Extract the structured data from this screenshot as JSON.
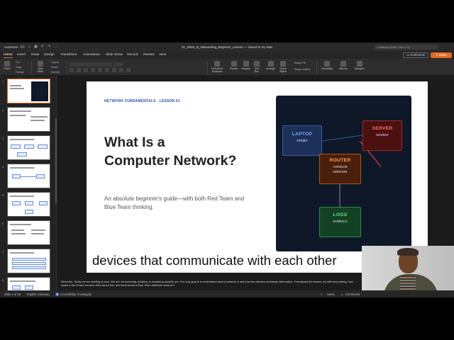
{
  "titlebar": {
    "autosave": "AutoSave",
    "document": "01_What_Is_Networking_Beginner_Lesson",
    "save_state": "Saved to my Mac",
    "search": "Search (Cmd + Ctrl + U)"
  },
  "tabs": [
    "Home",
    "Insert",
    "Draw",
    "Design",
    "Transitions",
    "Animations",
    "Slide Show",
    "Record",
    "Review",
    "View"
  ],
  "actions": {
    "comments": "Comments",
    "share": "Share"
  },
  "ribbon": {
    "paste": "Paste",
    "cut": "Cut",
    "copy": "Copy",
    "format": "Format",
    "new_slide": "New Slide",
    "layout": "Layout",
    "reset": "Reset",
    "section": "Section",
    "convert_smartart": "Convert to SmartArt",
    "picture": "Picture",
    "shapes": "Shapes",
    "text_box": "Text Box",
    "arrange": "Arrange",
    "quick_styles": "Quick Styles",
    "shape_fill": "Shape Fill",
    "shape_outline": "Shape Outline",
    "sensitivity": "Sensitivity",
    "add_ins": "Add-ins",
    "designer": "Designer"
  },
  "slide": {
    "eyebrow": "NETWORK FUNDAMENTALS · LESSON 01",
    "title_line1": "What Is a",
    "title_line2": "Computer Network?",
    "subtitle": "An absolute beginner's guide—with both Red Team and Blue Team thinking.",
    "nodes": {
      "laptop": {
        "title": "LAPTOP",
        "sub": "sender"
      },
      "server": {
        "title": "SERVER",
        "sub": "receiver"
      },
      "router": {
        "title": "ROUTER",
        "sub1": "connects",
        "sub2": "networks"
      },
      "logs": {
        "title": "LOGS",
        "sub": "evidence"
      }
    }
  },
  "caption": "devices that communicate with each other",
  "notes": "Welcome. Today we are starting at zero. We are not scanning, hacking, or analyzing packets yet. Our only goal is to understand what a network is and how two devices exchange information. Throughout the lesson, we will keep asking: how would a Red Team member think about this, and what would a Blue Team defender observe?",
  "status": {
    "slide_count": "Slide 1 of 18",
    "language": "English (Albania)",
    "accessibility": "Accessibility: Investigate",
    "notes": "Notes",
    "comments": "Comments"
  },
  "thumbnail_numbers": [
    "1",
    "2",
    "3",
    "4",
    "5",
    "6",
    "7",
    "8"
  ],
  "colors": {
    "accent": "#e86a2c",
    "eyebrow": "#2f4fa8",
    "laptop": "#7fa9f7",
    "server": "#ff6a6a",
    "router": "#ffa060",
    "logs": "#66e08b"
  }
}
